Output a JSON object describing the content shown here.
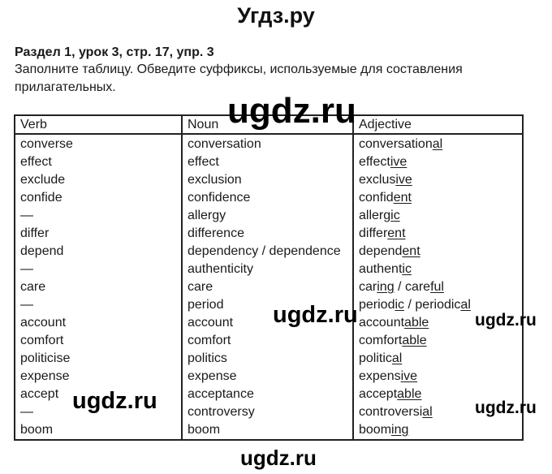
{
  "site_title": "Угдз.ру",
  "heading": "Раздел 1, урок 3, стр. 17, упр. 3",
  "instruction": "Заполните таблицу. Обведите суффиксы, используемые для составления прилагательных.",
  "watermarks": [
    "ugdz.ru",
    "ugdz.ru",
    "ugdz.ru",
    "ugdz.ru",
    "ugdz.ru",
    "ugdz.ru"
  ],
  "table": {
    "headers": [
      "Verb",
      "Noun",
      "Adjective"
    ],
    "rows": [
      {
        "verb": "converse",
        "noun": "conversation",
        "adjective": [
          {
            "stem": "conversation",
            "suffix": "al"
          }
        ]
      },
      {
        "verb": "effect",
        "noun": "effect",
        "adjective": [
          {
            "stem": "effect",
            "suffix": "ive"
          }
        ]
      },
      {
        "verb": "exclude",
        "noun": "exclusion",
        "adjective": [
          {
            "stem": "exclus",
            "suffix": "ive"
          }
        ]
      },
      {
        "verb": "confide",
        "noun": "confidence",
        "adjective": [
          {
            "stem": "confid",
            "suffix": "ent"
          }
        ]
      },
      {
        "verb": "—",
        "noun": "allergy",
        "adjective": [
          {
            "stem": "allerg",
            "suffix": "ic"
          }
        ]
      },
      {
        "verb": "differ",
        "noun": "difference",
        "adjective": [
          {
            "stem": "differ",
            "suffix": "ent"
          }
        ]
      },
      {
        "verb": "depend",
        "noun": "dependency / dependence",
        "adjective": [
          {
            "stem": "depend",
            "suffix": "ent"
          }
        ]
      },
      {
        "verb": "—",
        "noun": "authenticity",
        "adjective": [
          {
            "stem": "authent",
            "suffix": "ic"
          }
        ]
      },
      {
        "verb": "care",
        "noun": "care",
        "adjective": [
          {
            "stem": "car",
            "suffix": "ing"
          },
          {
            "stem": "care",
            "suffix": "ful"
          }
        ]
      },
      {
        "verb": "—",
        "noun": "period",
        "adjective": [
          {
            "stem": "period",
            "suffix": "ic"
          },
          {
            "stem": "periodic",
            "suffix": "al"
          }
        ]
      },
      {
        "verb": "account",
        "noun": "account",
        "adjective": [
          {
            "stem": "account",
            "suffix": "able"
          }
        ]
      },
      {
        "verb": "comfort",
        "noun": "comfort",
        "adjective": [
          {
            "stem": "comfort",
            "suffix": "able"
          }
        ]
      },
      {
        "verb": "politicise",
        "noun": "politics",
        "adjective": [
          {
            "stem": "politic",
            "suffix": "al"
          }
        ]
      },
      {
        "verb": "expense",
        "noun": "expense",
        "adjective": [
          {
            "stem": "expens",
            "suffix": "ive"
          }
        ]
      },
      {
        "verb": "accept",
        "noun": "acceptance",
        "adjective": [
          {
            "stem": "accept",
            "suffix": "able"
          }
        ]
      },
      {
        "verb": "—",
        "noun": "controversy",
        "adjective": [
          {
            "stem": "controversi",
            "suffix": "al"
          }
        ]
      },
      {
        "verb": "boom",
        "noun": "boom",
        "adjective": [
          {
            "stem": "boom",
            "suffix": "ing"
          }
        ]
      }
    ],
    "separator": " / "
  }
}
